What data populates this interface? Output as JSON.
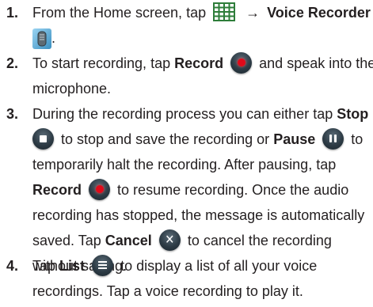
{
  "steps": [
    {
      "number": "1.",
      "part1": "From the Home screen, tap",
      "arrow": "→",
      "app_name": "Voice Recorder",
      "end": "."
    },
    {
      "number": "2.",
      "part1": "To start recording, tap",
      "record_label": "Record",
      "part2": "and speak into the",
      "part3": "microphone."
    },
    {
      "number": "3.",
      "part1": "During the recording process you can either tap",
      "stop_label": "Stop",
      "part2": "to stop and save the recording or",
      "pause_label": "Pause",
      "part3": "to",
      "part4": "temporarily halt the recording. After pausing, tap",
      "record_label": "Record",
      "part5": "to resume recording. Once the audio",
      "part6": "recording has stopped, the message is automatically",
      "part7": "saved. Tap",
      "cancel_label": "Cancel",
      "part8": "to cancel the recording",
      "part9": "without saving."
    },
    {
      "number": "4.",
      "part1": "Tap",
      "list_label": "List",
      "part2": "to display a list of all your voice",
      "part3": "recordings. Tap a voice recording to play it."
    }
  ],
  "icons": {
    "apps": "apps-grid-icon",
    "voice_recorder": "voice-recorder-app-icon",
    "record": "record-icon",
    "stop": "stop-icon",
    "pause": "pause-icon",
    "cancel": "cancel-icon",
    "list": "list-icon"
  },
  "colors": {
    "text": "#231f20",
    "record_red": "#e00a1a",
    "button_dark": "#2d3b45",
    "grid_green": "#2e7d3a"
  }
}
